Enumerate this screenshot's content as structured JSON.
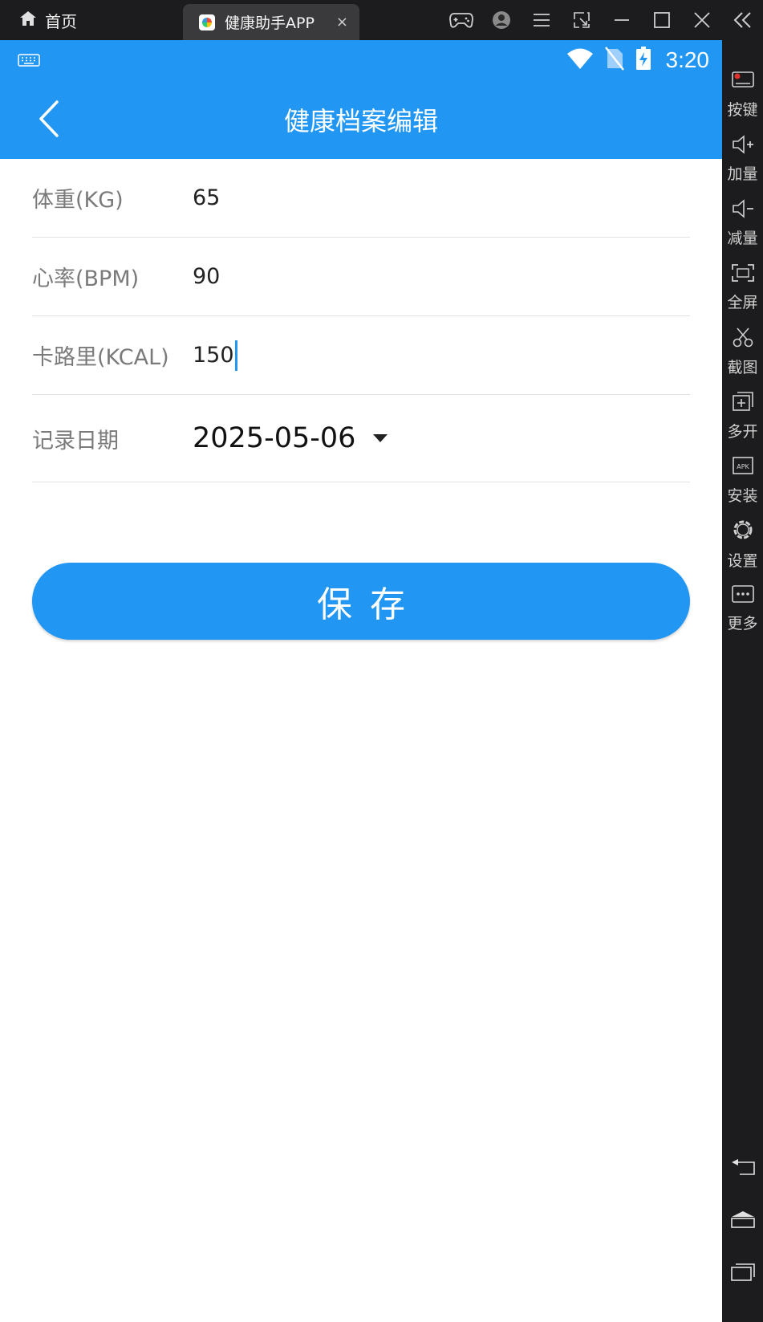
{
  "emulator": {
    "home_tab_label": "首页",
    "app_tab_label": "健康助手APP",
    "tab_close_glyph": "×",
    "sidebar": [
      {
        "label": "按键",
        "icon": "keymap-icon"
      },
      {
        "label": "加量",
        "icon": "volume-up-icon"
      },
      {
        "label": "减量",
        "icon": "volume-down-icon"
      },
      {
        "label": "全屏",
        "icon": "fullscreen-icon"
      },
      {
        "label": "截图",
        "icon": "scissors-icon"
      },
      {
        "label": "多开",
        "icon": "multi-instance-icon"
      },
      {
        "label": "安装",
        "icon": "apk-icon"
      },
      {
        "label": "设置",
        "icon": "gear-icon"
      },
      {
        "label": "更多",
        "icon": "more-icon"
      }
    ]
  },
  "status_bar": {
    "time": "3:20"
  },
  "app_bar": {
    "title": "健康档案编辑"
  },
  "form": {
    "weight": {
      "label": "体重(KG)",
      "value": "65"
    },
    "heart_rate": {
      "label": "心率(BPM)",
      "value": "90"
    },
    "calories": {
      "label": "卡路里(KCAL)",
      "value": "150"
    },
    "record_date": {
      "label": "记录日期",
      "value": "2025-05-06"
    }
  },
  "save_button": {
    "label": "保存"
  },
  "colors": {
    "primary": "#2196f3",
    "emulator_chrome": "#1c1c1e"
  }
}
